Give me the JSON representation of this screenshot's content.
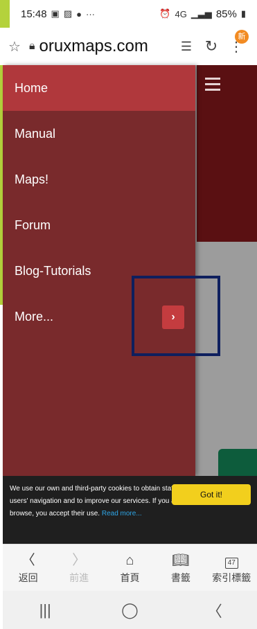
{
  "status_bar": {
    "time": "15:48",
    "left_icons": [
      "image-icon",
      "gallery-icon",
      "line-icon"
    ],
    "more": "···",
    "network": "4G",
    "battery": "85%"
  },
  "url_bar": {
    "domain": "oruxmaps.com",
    "badge": "新"
  },
  "drawer": {
    "items": [
      {
        "label": "Home"
      },
      {
        "label": "Manual"
      },
      {
        "label": "Maps!"
      },
      {
        "label": "Forum"
      },
      {
        "label": "Blog-Tutorials"
      },
      {
        "label": "More..."
      }
    ],
    "more_arrow": "›"
  },
  "cookie_banner": {
    "text": "We use our own and third-party cookies to obtain statistical data about our users' navigation and to improve our services. If you accept or continue to browse, you accept their use.",
    "link": "Read more...",
    "button": "Got it!"
  },
  "toolbar": {
    "back": "返回",
    "forward": "前進",
    "home": "首頁",
    "bookmarks": "書籤",
    "tabs": "索引標籤",
    "tab_count": "47"
  },
  "colors": {
    "drawer_bg": "#792a2c",
    "drawer_active": "#b0383c",
    "cookie_button": "#f2cf1d",
    "highlight": "#0e1f5e"
  }
}
